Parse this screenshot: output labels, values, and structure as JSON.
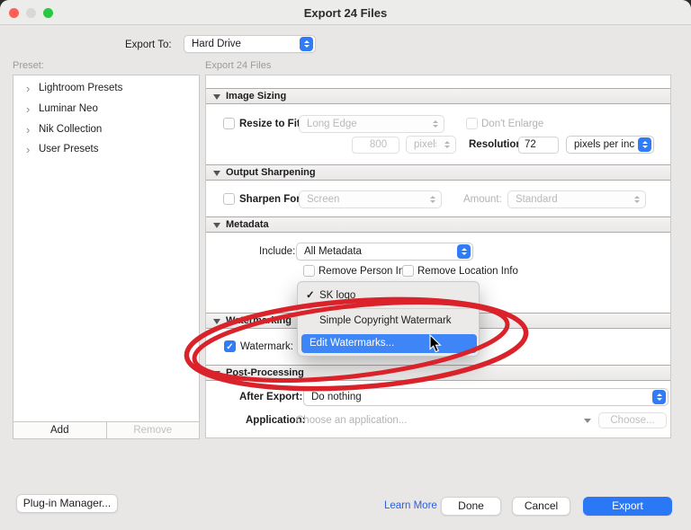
{
  "window": {
    "title": "Export 24 Files"
  },
  "header": {
    "export_to_label": "Export To:",
    "export_to_value": "Hard Drive"
  },
  "sidebar": {
    "preset_label": "Preset:",
    "items": [
      {
        "label": "Lightroom Presets"
      },
      {
        "label": "Luminar Neo"
      },
      {
        "label": "Nik Collection"
      },
      {
        "label": "User Presets"
      }
    ],
    "add_label": "Add",
    "remove_label": "Remove"
  },
  "main": {
    "panel_title": "Export 24 Files",
    "image_sizing": {
      "title": "Image Sizing",
      "resize_label": "Resize to Fit:",
      "resize_value": "Long Edge",
      "dont_enlarge_label": "Don't Enlarge",
      "size_value": "800",
      "unit_value": "pixels",
      "resolution_label": "Resolution:",
      "resolution_value": "72",
      "resolution_unit": "pixels per inch"
    },
    "output_sharpening": {
      "title": "Output Sharpening",
      "sharpen_label": "Sharpen For:",
      "sharpen_value": "Screen",
      "amount_label": "Amount:",
      "amount_value": "Standard"
    },
    "metadata": {
      "title": "Metadata",
      "include_label": "Include:",
      "include_value": "All Metadata",
      "remove_person_label": "Remove Person Info",
      "remove_location_label": "Remove Location Info"
    },
    "watermarking": {
      "title": "Watermarking",
      "watermark_label": "Watermark:"
    },
    "post_processing": {
      "title": "Post-Processing",
      "after_export_label": "After Export:",
      "after_export_value": "Do nothing",
      "application_label": "Application:",
      "application_placeholder": "Choose an application...",
      "choose_label": "Choose..."
    }
  },
  "menu": {
    "items": [
      {
        "label": "SK logo",
        "checked": true
      },
      {
        "label": "Simple Copyright Watermark",
        "checked": false
      },
      {
        "label": "Edit Watermarks...",
        "checked": false,
        "highlighted": true
      }
    ]
  },
  "footer": {
    "plugin_manager_label": "Plug-in Manager...",
    "learn_more_label": "Learn More",
    "done_label": "Done",
    "cancel_label": "Cancel",
    "export_label": "Export"
  },
  "colors": {
    "accent_blue": "#2b78f6",
    "menu_highlight": "#3e86f7",
    "annotation_red": "#d9222a",
    "traffic_red": "#ff5f57",
    "traffic_green": "#28c840"
  }
}
